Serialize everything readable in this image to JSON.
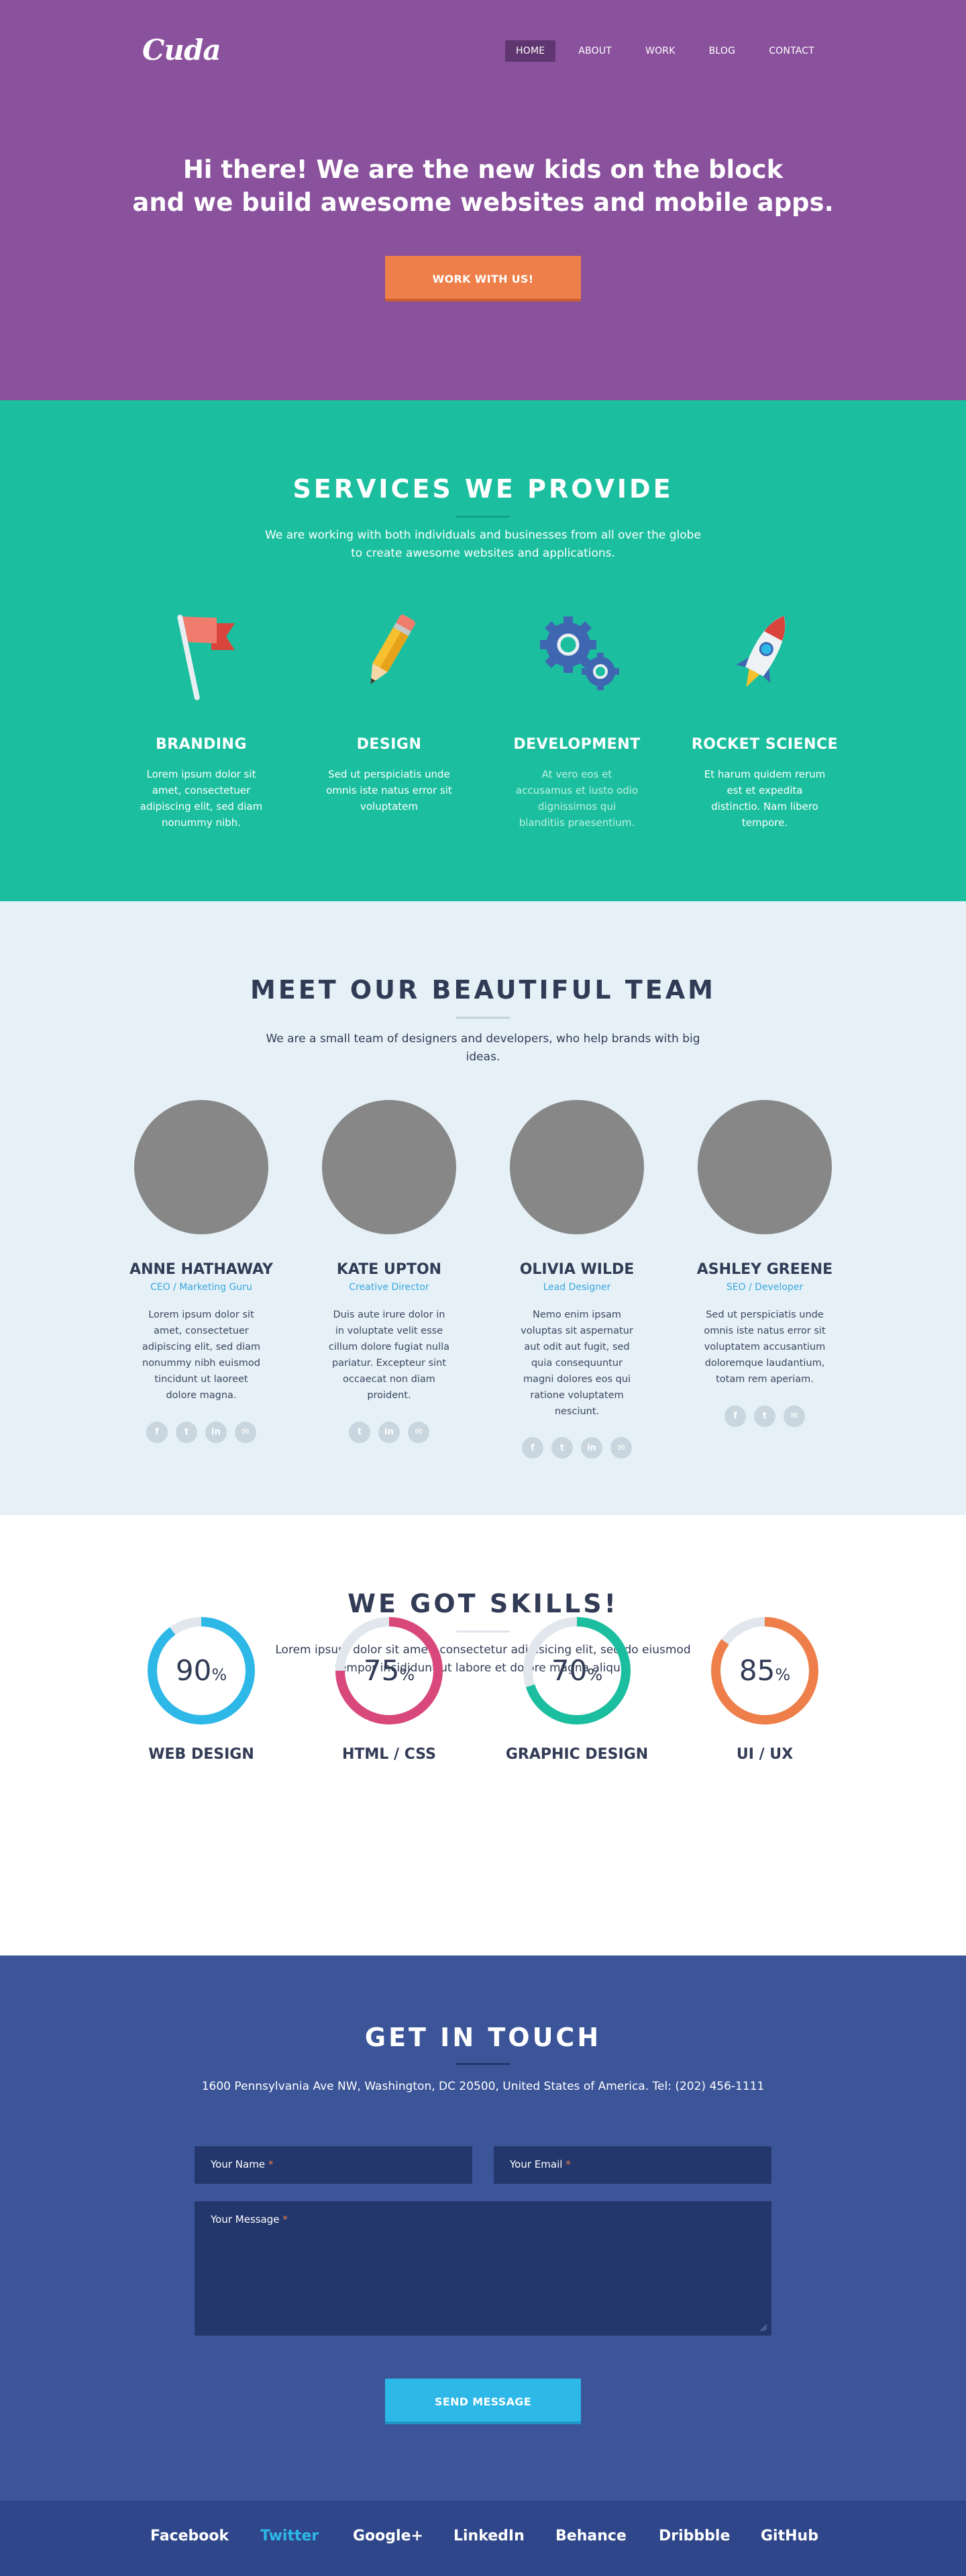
{
  "brand": {
    "logo": "Cuda"
  },
  "nav": {
    "items": [
      "HOME",
      "ABOUT",
      "WORK",
      "BLOG",
      "CONTACT"
    ],
    "active": "HOME"
  },
  "hero": {
    "title_line1": "Hi there! We are the new kids on the block",
    "title_line2": "and we build awesome websites and mobile apps.",
    "cta_label": "WORK WITH US!"
  },
  "services": {
    "title": "SERVICES WE PROVIDE",
    "subtitle_line1": "We are working with both individuals and businesses from all over the globe",
    "subtitle_line2": "to create awesome websites and applications.",
    "items": [
      {
        "icon": "flag-icon",
        "title": "BRANDING",
        "desc": "Lorem ipsum dolor sit amet, consectetuer adipiscing elit, sed diam nonummy nibh."
      },
      {
        "icon": "pencil-icon",
        "title": "DESIGN",
        "desc": "Sed ut perspiciatis unde omnis iste natus error sit voluptatem"
      },
      {
        "icon": "gears-icon",
        "title": "DEVELOPMENT",
        "desc": "At vero eos et accusamus et iusto odio dignissimos qui blanditiis praesentium."
      },
      {
        "icon": "rocket-icon",
        "title": "ROCKET SCIENCE",
        "desc": "Et harum quidem rerum est et expedita distinctio. Nam libero tempore."
      }
    ]
  },
  "team": {
    "title": "MEET OUR BEAUTIFUL TEAM",
    "subtitle": "We are a small team of designers and developers, who help brands with big ideas.",
    "members": [
      {
        "name": "ANNE HATHAWAY",
        "role": "CEO / Marketing Guru",
        "bio": "Lorem ipsum dolor sit amet, consectetuer adipiscing elit, sed diam nonummy nibh euismod tincidunt ut laoreet dolore magna."
      },
      {
        "name": "KATE UPTON",
        "role": "Creative Director",
        "bio": "Duis aute irure dolor in in voluptate velit esse cillum dolore fugiat nulla pariatur. Excepteur sint occaecat non diam proident."
      },
      {
        "name": "OLIVIA WILDE",
        "role": "Lead Designer",
        "bio": "Nemo enim ipsam voluptas sit aspernatur aut odit aut fugit, sed quia consequuntur magni dolores eos qui ratione voluptatem nesciunt."
      },
      {
        "name": "ASHLEY GREENE",
        "role": "SEO / Developer",
        "bio": "Sed ut perspiciatis unde omnis iste natus error sit voluptatem accusantium doloremque laudantium, totam rem aperiam."
      }
    ],
    "social_glyphs": {
      "facebook": "f",
      "twitter": "t",
      "linkedin": "in",
      "email": "✉"
    }
  },
  "skills": {
    "title": "WE GOT SKILLS!",
    "subtitle_line1": "Lorem ipsum dolor sit amet, consectetur adipisicing elit, sed do eiusmod",
    "subtitle_line2": "tempor incididunt ut labore et dolore magna aliqua.",
    "items": [
      {
        "label": "WEB DESIGN",
        "value": "90",
        "fraction": 0.9,
        "color": "#2db8e8"
      },
      {
        "label": "HTML / CSS",
        "value": "75",
        "fraction": 0.75,
        "color": "#d9487b"
      },
      {
        "label": "GRAPHIC DESIGN",
        "value": "70",
        "fraction": 0.7,
        "color": "#1bbf9f"
      },
      {
        "label": "UI / UX",
        "value": "85",
        "fraction": 0.85,
        "color": "#ee7f4a"
      }
    ],
    "unit": "%"
  },
  "contact": {
    "title": "GET IN TOUCH",
    "address": "1600 Pennsylvania Ave NW, Washington, DC 20500, United States of America. Tel: (202) 456-1111",
    "name_placeholder": "Your Name",
    "email_placeholder": "Your Email",
    "message_placeholder": "Your Message",
    "required_mark": "*",
    "send_label": "SEND MESSAGE"
  },
  "footer": {
    "links": [
      "Facebook",
      "Twitter",
      "Google+",
      "LinkedIn",
      "Behance",
      "Dribbble",
      "GitHub"
    ],
    "active": "Twitter"
  },
  "colors": {
    "hero_bg": "#8a519d",
    "services_bg": "#1bbf9f",
    "team_bg": "#e5f0f7",
    "contact_bg": "#3c5599",
    "footer_bg": "#2f478a",
    "accent_orange": "#ee7f4a",
    "accent_blue": "#2db8e8"
  }
}
